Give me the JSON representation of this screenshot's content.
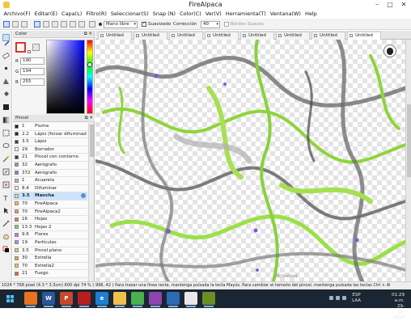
{
  "window": {
    "title": "FireAlpaca",
    "buttons": {
      "minimize": "–",
      "maximize": "□",
      "close": "✕"
    }
  },
  "menu": [
    "Archivo(F)",
    "Editar(E)",
    "Capa(L)",
    "Filtro(R)",
    "Seleccionar(S)",
    "Snap (N)",
    "Color(C)",
    "Ver(V)",
    "Herramienta(T)",
    "Ventana(W)",
    "Help"
  ],
  "toolbar": {
    "stroke_mode": "Mano libre",
    "smooth_label": "Suavizado",
    "smooth_checked": true,
    "correction_label": "Corrección",
    "correction_value": "40",
    "soft_edges_label": "Bordes Suaves",
    "soft_edges_checked": false
  },
  "tabs": [
    "Untitled",
    "Untitled",
    "Untitled",
    "Untitled",
    "Untitled",
    "Untitled",
    "Untitled",
    "Untitled"
  ],
  "active_tab_index": 7,
  "color_panel": {
    "title": "Color",
    "panel_buttons": "⧉ ✕",
    "r_label": "R",
    "r_value": "190",
    "g_label": "G",
    "g_value": "194",
    "b_label": "B",
    "b_value": "255"
  },
  "brush_panel": {
    "title": "Pincel",
    "panel_buttons": "⧉ ✕",
    "items": [
      {
        "size": "1",
        "name": "Pluma",
        "color": "#222222"
      },
      {
        "size": "2.2",
        "name": "Lápiz (forzar difuminad",
        "color": "#222222"
      },
      {
        "size": "3.5",
        "name": "Lápiz",
        "color": "#444444"
      },
      {
        "size": "29",
        "name": "Borrador",
        "color": "#ffffff"
      },
      {
        "size": "21",
        "name": "Pincel con contorno",
        "color": "#3a3a3a"
      },
      {
        "size": "32",
        "name": "Aerógrafo",
        "color": "#9a9a9a"
      },
      {
        "size": "372",
        "name": "Aerógrafo",
        "color": "#5b8fd9"
      },
      {
        "size": "1",
        "name": "Acuarela",
        "color": "#c9a7e8"
      },
      {
        "size": "8.4",
        "name": "Difuminar",
        "color": "#f0f0f0"
      },
      {
        "size": "3.5",
        "name": "Mancha",
        "color": "#e8d9a0"
      },
      {
        "size": "70",
        "name": "FireAlpaca",
        "color": "#f2c23a"
      },
      {
        "size": "70",
        "name": "FireAlpaca2",
        "color": "#f29a3a"
      },
      {
        "size": "16",
        "name": "Hojas",
        "color": "#f06a6a"
      },
      {
        "size": "13.3",
        "name": "Hojas 2",
        "color": "#8ad06a"
      },
      {
        "size": "9.6",
        "name": "Flores",
        "color": "#e86ad9"
      },
      {
        "size": "19",
        "name": "Partículas",
        "color": "#a98ee8"
      },
      {
        "size": "3.5",
        "name": "Pincel plano",
        "color": "#c6e36a"
      },
      {
        "size": "30",
        "name": "Estrella",
        "color": "#f0a13a"
      },
      {
        "size": "70",
        "name": "Estrella2",
        "color": "#f0d03a"
      },
      {
        "size": "21",
        "name": "Fuego",
        "color": "#f05a2a"
      }
    ],
    "selected_index": 9
  },
  "canvas": {
    "watermark": "FA/Untitled"
  },
  "status": {
    "text": "1024 * 768 pixel  (4.3 * 3.3cm)  600 dpi  74 %  ( 998, 42 )  Para trazar una línea recta, mantenga pulsada la tecla Mayús. Para cambiar el tamaño del pincel, mantenga pulsada las teclas Ctrl + Al"
  },
  "taskbar": {
    "apps": [
      {
        "label": "",
        "name": "firefox",
        "color": "#e7731e"
      },
      {
        "label": "W",
        "name": "word",
        "color": "#2b5797"
      },
      {
        "label": "P",
        "name": "powerpoint",
        "color": "#c8472a"
      },
      {
        "label": "",
        "name": "acrobat",
        "color": "#b81e1e"
      },
      {
        "label": "e",
        "name": "edge",
        "color": "#1d7fd1"
      },
      {
        "label": "",
        "name": "explorer",
        "color": "#f0c04a"
      },
      {
        "label": "",
        "name": "chrome",
        "color": "#4caf50"
      },
      {
        "label": "",
        "name": "media",
        "color": "#8e44ad"
      },
      {
        "label": "",
        "name": "store",
        "color": "#2e6ab3"
      },
      {
        "label": "",
        "name": "firealpaca",
        "color": "#e8e8e8"
      },
      {
        "label": "",
        "name": "misc",
        "color": "#6b8e23"
      }
    ],
    "lang_top": "ESP",
    "lang_bottom": "LAA",
    "time": "01:29 a.m.",
    "date": "29-11-2018"
  }
}
